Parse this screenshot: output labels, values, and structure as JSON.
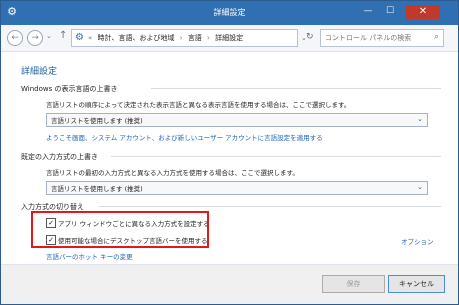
{
  "window": {
    "title": "詳細設定",
    "minimize": "—",
    "maximize": "☐",
    "close": "✕"
  },
  "nav": {
    "back": "←",
    "forward": "→",
    "history": "⌄",
    "up": "↑",
    "breadcrumbs": [
      "«",
      "時計、言語、および地域",
      "›",
      "言語",
      "›",
      "詳細設定"
    ],
    "address_drop": "⌄",
    "refresh": "↻",
    "search_placeholder": "コントロール パネルの検索",
    "search_icon": "⌕"
  },
  "main": {
    "heading": "詳細設定",
    "display_lang": {
      "title": "Windows の表示言語の上書き",
      "desc": "言語リストの順序によって決定された表示言語と異なる表示言語を使用する場合は、ここで選択します。",
      "select_value": "言語リストを使用します (推奨)",
      "link": "ようこそ画面、システム アカウント、および新しいユーザー アカウントに言語設定を適用する"
    },
    "input_method": {
      "title": "既定の入力方式の上書き",
      "desc": "言語リストの最初の入力方式と異なる入力方式を使用する場合は、ここで選択します。",
      "select_value": "言語リストを使用します (推奨)"
    },
    "switching": {
      "title": "入力方式の切り替え",
      "per_app_label": "アプリ ウィンドウごとに異なる入力方式を設定する",
      "per_app_checked": true,
      "desktop_bar_label": "使用可能な場合にデスクトップ言語バーを使用する",
      "desktop_bar_checked": true,
      "options_link": "オプション",
      "hotkey_link": "言語バーのホット キーの変更"
    }
  },
  "footer": {
    "save": "保存",
    "cancel": "キャンセル"
  },
  "colors": {
    "titlebar": "#2f6fb2",
    "link": "#1d63b8",
    "heading": "#1d5e9c",
    "highlight": "#e0191b"
  }
}
